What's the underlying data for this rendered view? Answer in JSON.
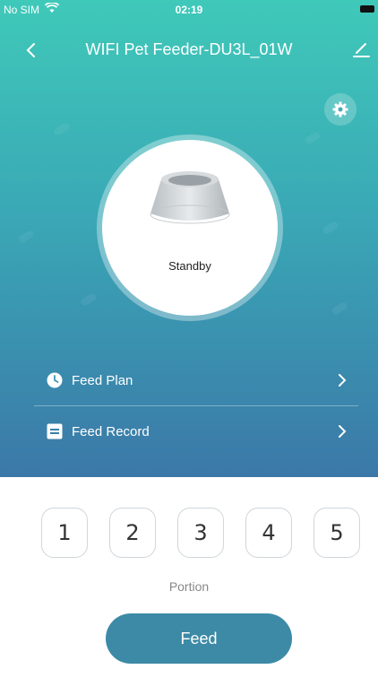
{
  "status_bar": {
    "carrier": "No SIM",
    "time": "02:19"
  },
  "navbar": {
    "title": "WIFI Pet Feeder-DU3L_01W"
  },
  "device": {
    "status": "Standby"
  },
  "menu": {
    "feed_plan": {
      "label": "Feed Plan",
      "icon": "clock-icon"
    },
    "feed_record": {
      "label": "Feed Record",
      "icon": "record-icon"
    }
  },
  "portion": {
    "options": [
      "1",
      "2",
      "3",
      "4",
      "5"
    ],
    "caption": "Portion"
  },
  "actions": {
    "feed_label": "Feed"
  },
  "colors": {
    "gradient_top": "#3fc9b9",
    "gradient_bottom": "#3b78a8",
    "feed_button": "#3d8aa6"
  }
}
